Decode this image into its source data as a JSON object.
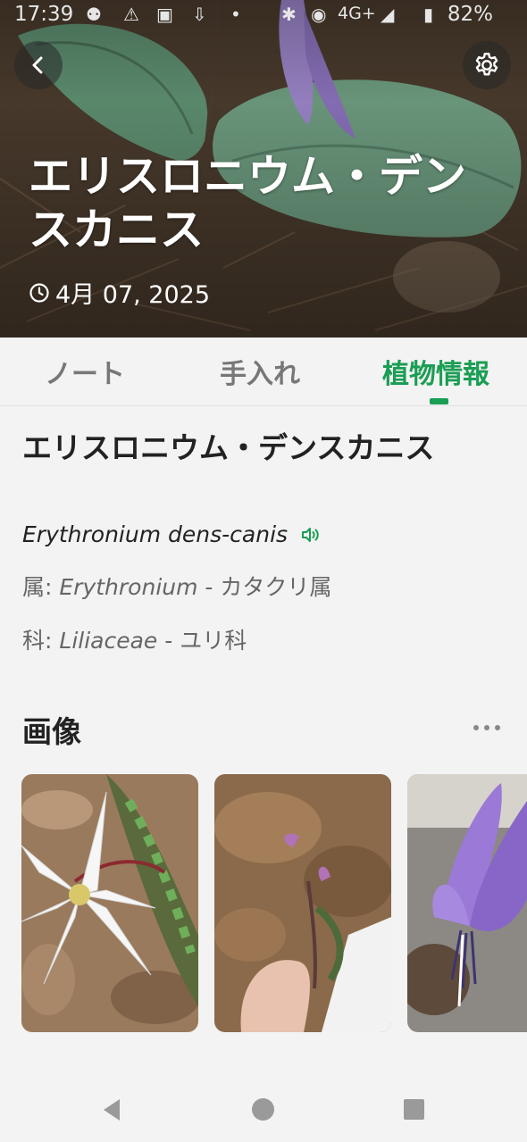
{
  "status_bar": {
    "time": "17:39",
    "network": "4G+",
    "battery": "82%"
  },
  "hero": {
    "back_icon": "chevron-left-icon",
    "settings_icon": "gear-icon",
    "title": "エリスロニウム・デンスカニス",
    "date": "4月 07, 2025",
    "clock_icon": "clock-icon"
  },
  "tabs": [
    {
      "label": "ノート",
      "active": false
    },
    {
      "label": "手入れ",
      "active": false
    },
    {
      "label": "植物情報",
      "active": true
    }
  ],
  "plant": {
    "name": "エリスロニウム・デンスカニス",
    "scientific_name": "Erythronium dens-canis",
    "speaker_icon": "speaker-icon",
    "genus_label": "属",
    "genus_sci": "Erythronium",
    "genus_common": "カタクリ属",
    "family_label": "科",
    "family_sci": "Liliaceae",
    "family_common": "ユリ科"
  },
  "images_section": {
    "title": "画像",
    "more_icon": "more-horizontal-icon"
  },
  "colors": {
    "accent": "#1a9e54",
    "text_dark": "#222222",
    "text_muted": "#666666",
    "background": "#f3f3f3"
  },
  "nav_bar": {
    "back": "nav-back-icon",
    "home": "nav-home-icon",
    "recents": "nav-recents-icon"
  }
}
